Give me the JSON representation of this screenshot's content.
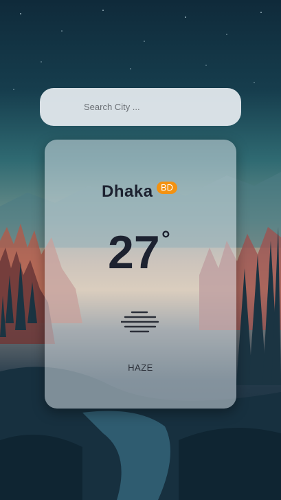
{
  "search": {
    "placeholder": "Search City ..."
  },
  "weather": {
    "city": "Dhaka",
    "country": "BD",
    "temperature": "27",
    "degree_symbol": "°",
    "description": "HAZE",
    "icon": "haze-icon"
  },
  "colors": {
    "badge": "#f39211",
    "text_dark": "#1d2230"
  }
}
